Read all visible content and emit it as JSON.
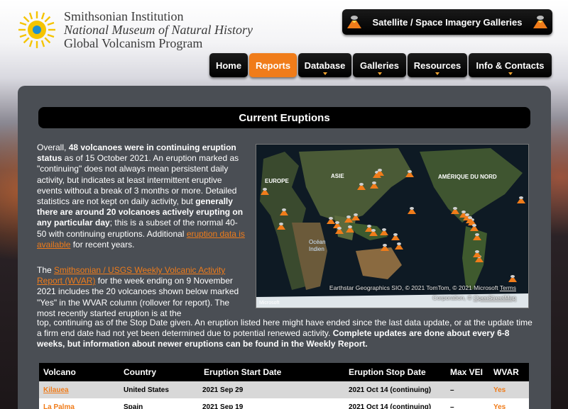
{
  "logo": {
    "line1": "Smithsonian Institution",
    "line2": "National Museum of Natural History",
    "line3": "Global Volcanism Program",
    "icon": "smithsonian-sun-icon"
  },
  "header": {
    "satellite_button": "Satellite / Space Imagery Galleries",
    "nav": [
      {
        "label": "Home",
        "active": false,
        "dropdown": false
      },
      {
        "label": "Reports",
        "active": true,
        "dropdown": false
      },
      {
        "label": "Database",
        "active": false,
        "dropdown": true
      },
      {
        "label": "Galleries",
        "active": false,
        "dropdown": true
      },
      {
        "label": "Resources",
        "active": false,
        "dropdown": true
      },
      {
        "label": "Info & Contacts",
        "active": false,
        "dropdown": true
      }
    ]
  },
  "main": {
    "title": "Current Eruptions",
    "intro": {
      "p1_a": "Overall, ",
      "p1_b": "48 volcanoes were in continuing eruption status",
      "p1_c": " as of 15 October 2021. An eruption marked as \"continuing\" does not always mean persistent daily activity, but indicates at least intermittent eruptive events without a break of 3 months or more. Detailed statistics are not kept on daily activity, but ",
      "p1_d": "generally there are around 20 volcanoes actively erupting on any particular day",
      "p1_e": "; this is a subset of the normal 40-50 with continuing eruptions. Additional ",
      "p1_link": "eruption data is available",
      "p1_f": " for recent years."
    },
    "wvar": {
      "a": "The ",
      "link": "Smithsonian / USGS Weekly Volcanic Activity Report (WVAR)",
      "b": " for the week ending on 9 November 2021 includes the 20 volcanoes shown below marked \"Yes\" in the WVAR column (rollover for report). The most recently started eruption is at the"
    },
    "wide": {
      "a": "top, continuing as of the Stop Date given. An eruption listed here might have ended since the last data update, or at the update time a firm end date had not yet been determined due to potential renewed activity. ",
      "b": "Complete updates are done about every 6-8 weeks, but information about newer eruptions can be found in the Weekly Report."
    },
    "map": {
      "labels": {
        "europe": "EUROPE",
        "asia": "ASIE",
        "north_america": "AMÉRIQUE DU NORD",
        "ocean": "Océan",
        "ocean2": "Indien"
      },
      "attribution_line1_a": "Earthstar Geographics SIO, © 2021 TomTom, © 2021 Microsoft",
      "attribution_terms": "Terms",
      "attribution_line2_a": "Corporation, © ",
      "attribution_osm": "OpenStreetMap",
      "ms_logo": "Microsoft"
    },
    "table": {
      "headers": [
        "Volcano",
        "Country",
        "Eruption Start Date",
        "Eruption Stop Date",
        "Max VEI",
        "WVAR"
      ],
      "rows": [
        {
          "volcano": "Kilauea",
          "country": "United States",
          "start": "2021 Sep 29",
          "stop": "2021 Oct 14 (continuing)",
          "vei": "–",
          "wvar": "Yes"
        },
        {
          "volcano": "La Palma",
          "country": "Spain",
          "start": "2021 Sep 19",
          "stop": "2021 Oct 14 (continuing)",
          "vei": "–",
          "wvar": "Yes"
        }
      ]
    }
  },
  "colors": {
    "accent": "#f07c1a",
    "panel": "#4a4e54",
    "nav_bg": "#000000"
  }
}
